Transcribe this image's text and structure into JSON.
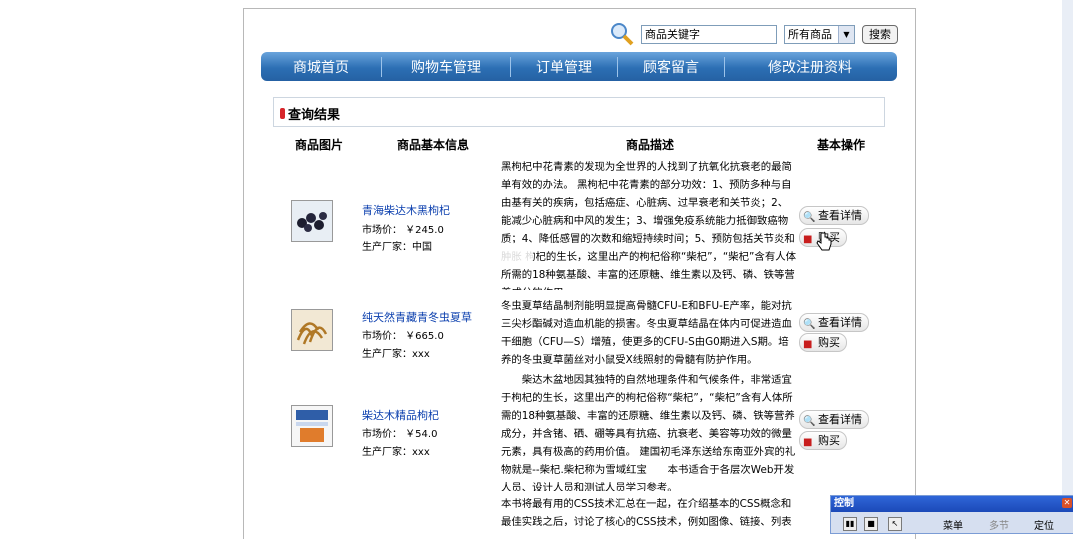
{
  "search": {
    "keyword_value": "商品关键字",
    "category_selected": "所有商品",
    "search_button": "搜索"
  },
  "nav": [
    {
      "label": "商城首页"
    },
    {
      "label": "购物车管理"
    },
    {
      "label": "订单管理"
    },
    {
      "label": "顾客留言"
    },
    {
      "label": "修改注册资料"
    }
  ],
  "section_title": "查询结果",
  "table_headers": {
    "image": "商品图片",
    "info": "商品基本信息",
    "description": "商品描述",
    "operation": "基本操作"
  },
  "products": [
    {
      "name": "青海柴达木黑枸杞",
      "price": "市场价：  ￥245.0",
      "maker": "生产厂家：中国",
      "description": "黑枸杞中花青素的发现为全世界的人找到了抗氧化抗衰老的最简单有效的办法。 黑枸杞中花青素的部分功效：1、预防多种与自由基有关的疾病，包括癌症、心脏病、过早衰老和关节炎；2、能减少心脏病和中风的发生；3、增强免疫系统能力抵御致癌物质；4、降低感冒的次数和缩短持续时间；5、预防包括关节炎和肿胀 枸杞的生长，这里出产的枸杞俗称“柴杞”，“柴杞”含有人体所需的18种氨基酸、丰富的还原糖、维生素以及钙、磷、铁等营养成分的作用"
    },
    {
      "name": "纯天然青藏青冬虫夏草",
      "price": "市场价：  ￥665.0",
      "maker": "生产厂家：xxx",
      "description": "冬虫夏草结晶制剂能明显提高骨髓CFU-E和BFU-E产率，能对抗三尖杉酯碱对造血机能的损害。冬虫夏草结晶在体内可促进造血干细胞（CFU—S）增殖，使更多的CFU-S由G0期进入S期。培养的冬虫夏草菌丝对小鼠受X线照射的骨髓有防护作用。"
    },
    {
      "name": "柴达木精品枸杞",
      "price": "市场价：  ￥54.0",
      "maker": "生产厂家：xxx",
      "description": "　　柴达木盆地因其独特的自然地理条件和气候条件，非常适宜于枸杞的生长，这里出产的枸杞俗称“柴杞”，“柴杞”含有人体所需的18种氨基酸、丰富的还原糖、维生素以及钙、磷、铁等营养成分，并含锗、硒、硼等具有抗癌、抗衰老、美容等功效的微量元素，具有极高的药用价值。 建国初毛泽东送给东南亚外宾的礼物就是--柴杞.柴杞称为雪域红宝　　本书适合于各层次Web开发人员、设计人员和测试人员学习参考。"
    }
  ],
  "partial_description": "本书将最有用的CSS技术汇总在一起，在介绍基本的CSS概念和最佳实践之后，讨论了核心的CSS技术，例如图像、链接、列表操",
  "buttons": {
    "detail": "查看详情",
    "buy": "购买"
  },
  "control_panel": {
    "title": "控制",
    "menu": "菜单",
    "multi": "多节",
    "locate": "定位"
  },
  "colors": {
    "nav_blue": "#2c6fb4",
    "link_blue": "#0b3fae",
    "accent_red": "#d7262b"
  }
}
